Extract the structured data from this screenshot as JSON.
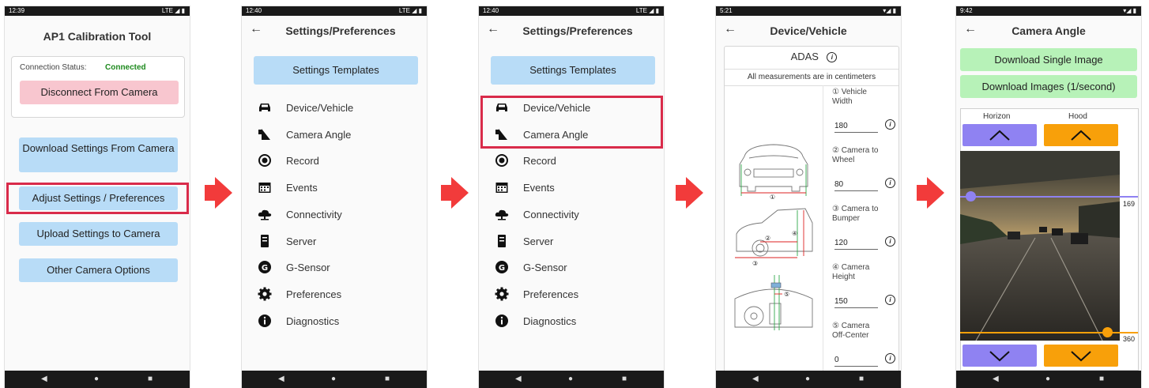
{
  "screens": [
    {
      "status": {
        "time": "12:39",
        "right": "LTE ◢ ▮"
      },
      "title": "AP1 Calibration Tool",
      "connection": {
        "label": "Connection Status:",
        "value": "Connected",
        "color": "#1e8a1e"
      },
      "disconnect_label": "Disconnect From Camera",
      "buttons": [
        "Download Settings From Camera",
        "Adjust Settings / Preferences",
        "Upload Settings to Camera",
        "Other Camera Options"
      ]
    },
    {
      "status": {
        "time": "12:40",
        "right": "LTE ◢ ▮"
      },
      "title": "Settings/Preferences",
      "templates_label": "Settings Templates",
      "menu": [
        "Device/Vehicle",
        "Camera Angle",
        "Record",
        "Events",
        "Connectivity",
        "Server",
        "G-Sensor",
        "Preferences",
        "Diagnostics"
      ]
    },
    {
      "status": {
        "time": "12:40",
        "right": "LTE ◢ ▮"
      },
      "title": "Settings/Preferences",
      "templates_label": "Settings Templates",
      "menu": [
        "Device/Vehicle",
        "Camera Angle",
        "Record",
        "Events",
        "Connectivity",
        "Server",
        "G-Sensor",
        "Preferences",
        "Diagnostics"
      ]
    },
    {
      "status": {
        "time": "5:21",
        "right": "▾◢ ▮"
      },
      "title": "Device/Vehicle",
      "section": "ADAS",
      "note": "All measurements are in centimeters",
      "measurements": [
        {
          "label": "① Vehicle Width",
          "value": "180"
        },
        {
          "label": "② Camera to Wheel",
          "value": "80"
        },
        {
          "label": "③ Camera to Bumper",
          "value": "120"
        },
        {
          "label": "④ Camera Height",
          "value": "150"
        },
        {
          "label": "⑤ Camera Off-Center",
          "value": "0"
        }
      ],
      "diagram_marks": [
        "①",
        "②",
        "③",
        "④",
        "⑤"
      ]
    },
    {
      "status": {
        "time": "9:42",
        "right": "▾◢ ▮"
      },
      "title": "Camera Angle",
      "download_single": "Download Single Image",
      "download_images": "Download Images (1/second)",
      "horizon_label": "Horizon",
      "hood_label": "Hood",
      "horizon_value": "169",
      "hood_value": "360"
    }
  ],
  "colors": {
    "blue_button": "#b8dcf7",
    "pink_button": "#f8c6cf",
    "green_button": "#b7f2b8",
    "highlight": "#d92b4a",
    "horizon_purple": "#8f82f2",
    "hood_orange": "#f8a00a",
    "step_arrow": "#f23b3b"
  },
  "icons": [
    "car-icon",
    "camera-angle-icon",
    "record-icon",
    "calendar-icon",
    "cloud-icon",
    "server-icon",
    "g-sensor-icon",
    "gear-icon",
    "info-icon"
  ]
}
